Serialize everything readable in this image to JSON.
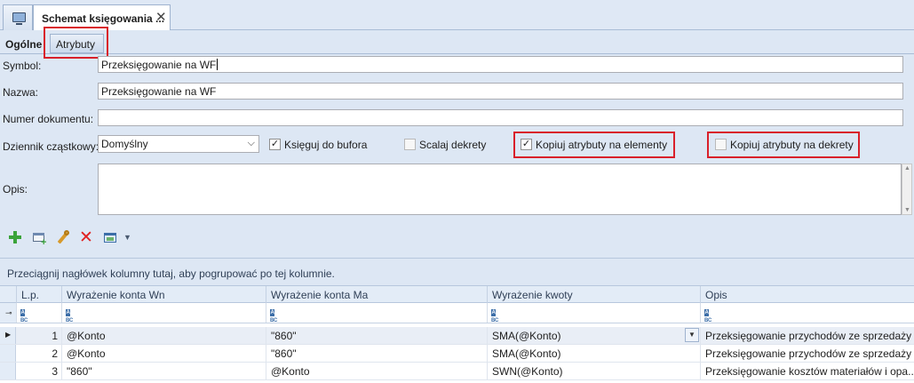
{
  "tabs": {
    "home_icon": "monitor-icon",
    "document_tab": "Schemat księgowania ...",
    "close_glyph": "✕"
  },
  "subtabs": {
    "general": "Ogólne",
    "attributes": "Atrybuty"
  },
  "form": {
    "symbol_label": "Symbol:",
    "symbol_value": "Przeksięgowanie na WF",
    "name_label": "Nazwa:",
    "name_value": "Przeksięgowanie na WF",
    "doc_number_label": "Numer dokumentu:",
    "doc_number_value": "",
    "journal_label": "Dziennik cząstkowy:",
    "journal_value": "Domyślny",
    "description_label": "Opis:",
    "description_value": ""
  },
  "options": {
    "post_to_buffer": {
      "label": "Księguj do bufora",
      "checked": true
    },
    "merge_entries": {
      "label": "Scalaj dekrety",
      "checked": false
    },
    "copy_attrs_elements": {
      "label": "Kopiuj atrybuty na elementy",
      "checked": true
    },
    "copy_attrs_entries": {
      "label": "Kopiuj atrybuty na dekrety",
      "checked": false
    }
  },
  "toolbar": {
    "icons": [
      "add-icon",
      "add-window-icon",
      "edit-icon",
      "delete-icon",
      "view-icon",
      "dropdown-arrow-icon"
    ]
  },
  "grid": {
    "group_panel_text": "Przeciągnij nagłówek kolumny tutaj, aby pogrupować po tej kolumnie.",
    "columns": [
      "L.p.",
      "Wyrażenie konta Wn",
      "Wyrażenie konta Ma",
      "Wyrażenie kwoty",
      "Opis"
    ],
    "filter_icon": "abc-filter-icon",
    "rows": [
      {
        "lp": "1",
        "wn": "@Konto",
        "ma": "\"860\"",
        "kwota": "SMA(@Konto)",
        "opis": "Przeksięgowanie przychodów ze sprzedaży ..."
      },
      {
        "lp": "2",
        "wn": "@Konto",
        "ma": "\"860\"",
        "kwota": "SMA(@Konto)",
        "opis": "Przeksięgowanie przychodów ze sprzedaży ..."
      },
      {
        "lp": "3",
        "wn": "\"860\"",
        "ma": "@Konto",
        "kwota": "SWN(@Konto)",
        "opis": "Przeksięgowanie kosztów materiałów i opa..."
      }
    ]
  },
  "colors": {
    "background": "#dde7f4",
    "highlight": "#d9202a",
    "add": "#3aa33a",
    "delete": "#e02020"
  }
}
